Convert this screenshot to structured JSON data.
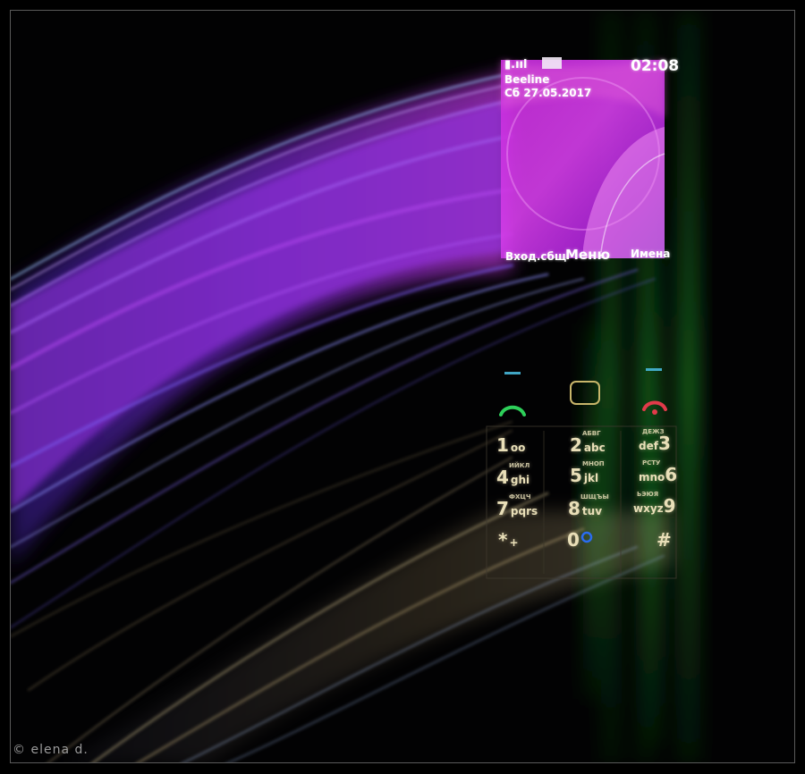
{
  "photo": {
    "subject": "long-exposure-mobile-phone-light-trails",
    "colors": {
      "background": "#000000",
      "screen_violet": "#c01ee0",
      "trail_purple": "#7a2cf0",
      "trail_gold": "#c9b078",
      "trail_green": "#1fb82e",
      "frame_border": "#5a5a5a"
    }
  },
  "phone_screen": {
    "signal_label": "▮.ııl",
    "time": "02:08",
    "operator": "Beeline",
    "date": "Сб 27.05.2017",
    "softkeys": {
      "left": "Вход.сбщ",
      "center": "Меню",
      "right": "Имена"
    }
  },
  "keypad": {
    "icons": [
      "call-icon",
      "select-key-icon",
      "end-call-icon"
    ],
    "keys": [
      {
        "digit": "1",
        "letters": "oo",
        "cyr": ""
      },
      {
        "digit": "2",
        "letters": "abc",
        "cyr": "АБВГ"
      },
      {
        "digit": "3",
        "letters": "def",
        "cyr": "ДЕЖЗ"
      },
      {
        "digit": "4",
        "letters": "ghi",
        "cyr": "ИЙКЛ"
      },
      {
        "digit": "5",
        "letters": "jkl",
        "cyr": "МНОП"
      },
      {
        "digit": "6",
        "letters": "mno",
        "cyr": "РСТУ"
      },
      {
        "digit": "7",
        "letters": "pqrs",
        "cyr": "ФХЦЧ"
      },
      {
        "digit": "8",
        "letters": "tuv",
        "cyr": "ШЩЪЫ"
      },
      {
        "digit": "9",
        "letters": "wxyz",
        "cyr": "ЬЭЮЯ"
      },
      {
        "digit": "*",
        "letters": "+",
        "cyr": ""
      },
      {
        "digit": "0",
        "letters": "",
        "cyr": ""
      },
      {
        "digit": "#",
        "letters": "",
        "cyr": ""
      }
    ]
  },
  "watermark": "© elena d."
}
